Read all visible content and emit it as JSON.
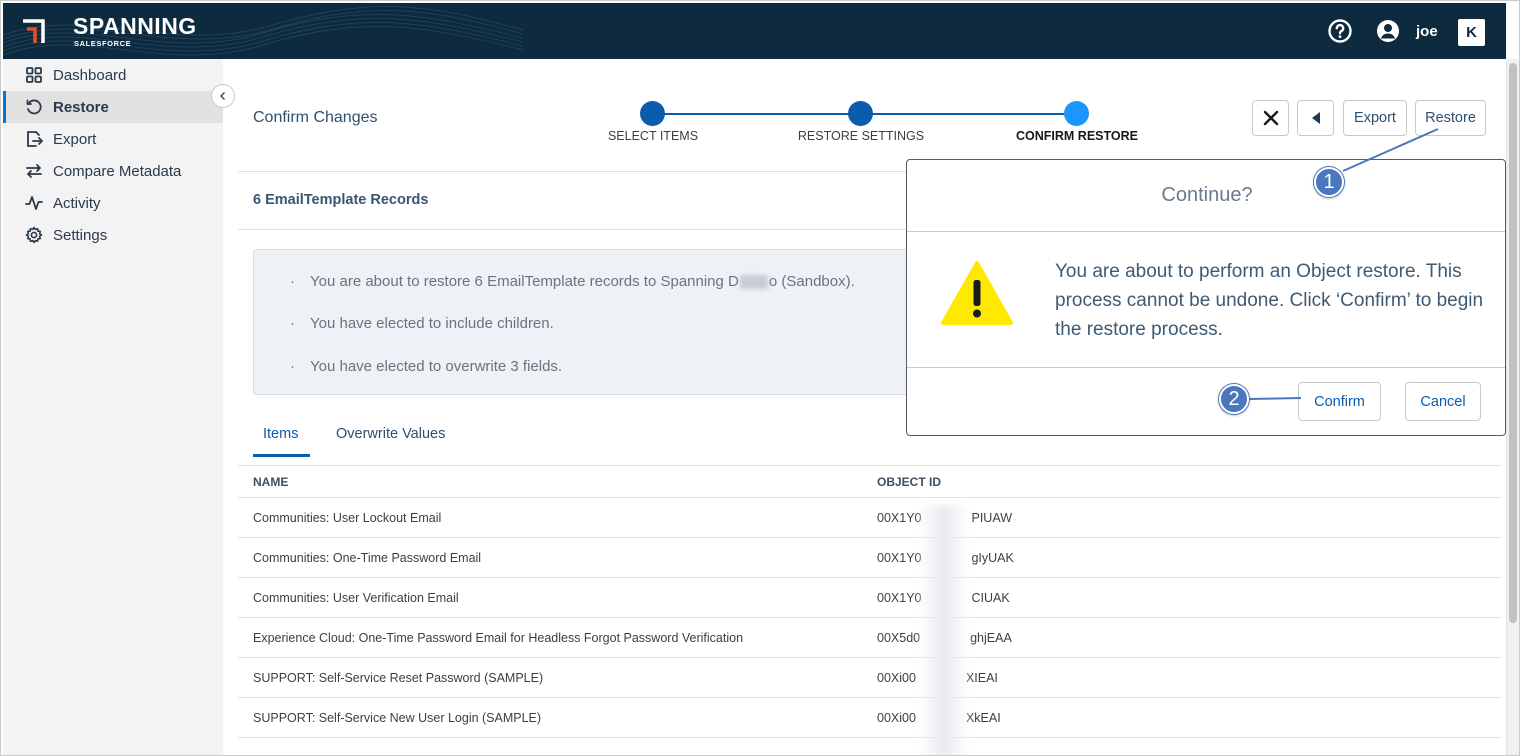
{
  "app": {
    "brand": "SPANNING",
    "brand_sub": "SALESFORCE",
    "user_name": "joe",
    "badge": "K"
  },
  "sidebar": {
    "items": [
      {
        "label": "Dashboard",
        "icon": "grid-icon"
      },
      {
        "label": "Restore",
        "icon": "restore-icon",
        "active": true
      },
      {
        "label": "Export",
        "icon": "export-icon"
      },
      {
        "label": "Compare Metadata",
        "icon": "compare-icon"
      },
      {
        "label": "Activity",
        "icon": "activity-icon"
      },
      {
        "label": "Settings",
        "icon": "gear-icon"
      }
    ]
  },
  "page": {
    "title": "Confirm Changes",
    "steps": [
      {
        "label": "SELECT ITEMS"
      },
      {
        "label": "RESTORE SETTINGS"
      },
      {
        "label": "CONFIRM RESTORE",
        "current": true
      }
    ],
    "toolbar": {
      "export_label": "Export",
      "restore_label": "Restore"
    },
    "section_title": "6 EmailTemplate Records",
    "info": {
      "line1_prefix": "You are about to restore 6 EmailTemplate records to Spanning D",
      "line1_suffix": "o (Sandbox).",
      "line2": "You have elected to include children.",
      "line3": "You have elected to overwrite 3 fields."
    },
    "tabs": [
      {
        "label": "Items",
        "active": true
      },
      {
        "label": "Overwrite Values"
      }
    ],
    "table": {
      "columns": [
        "NAME",
        "OBJECT ID"
      ],
      "rows": [
        {
          "name": "Communities: User Lockout Email",
          "id_prefix": "00X1Y0",
          "id_suffix": "PIUAW"
        },
        {
          "name": "Communities: One-Time Password Email",
          "id_prefix": "00X1Y0",
          "id_suffix": "gIyUAK"
        },
        {
          "name": "Communities: User Verification Email",
          "id_prefix": "00X1Y0",
          "id_suffix": "CIUAK"
        },
        {
          "name": "Experience Cloud: One-Time Password Email for Headless Forgot Password Verification",
          "id_prefix": "00X5d0",
          "id_suffix": "ghjEAA"
        },
        {
          "name": "SUPPORT: Self-Service Reset Password (SAMPLE)",
          "id_prefix": "00Xi00",
          "id_suffix": "XIEAI"
        },
        {
          "name": "SUPPORT: Self-Service New User Login (SAMPLE)",
          "id_prefix": "00Xi00",
          "id_suffix": "XkEAI"
        }
      ]
    }
  },
  "modal": {
    "title": "Continue?",
    "message": "You are about to perform an Object restore. This process cannot be undone. Click ‘Confirm’ to begin the restore process.",
    "confirm_label": "Confirm",
    "cancel_label": "Cancel"
  },
  "callouts": [
    "1",
    "2"
  ],
  "colors": {
    "header_bg": "#0d2a3f",
    "accent": "#0b5cab",
    "current_step": "#1b96ff",
    "callout": "#4b77be",
    "warning": "#ffe900"
  }
}
